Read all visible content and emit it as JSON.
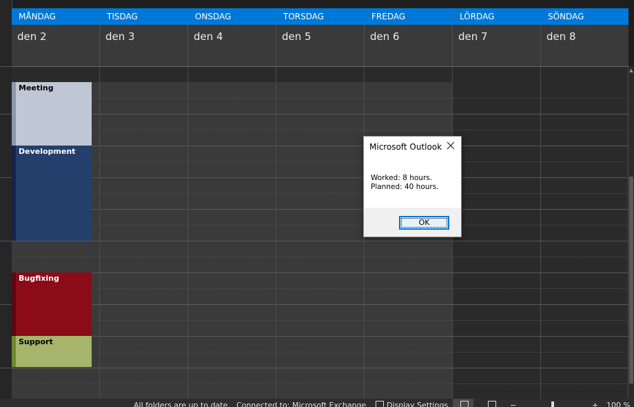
{
  "calendar": {
    "days": [
      {
        "name": "MÅNDAG",
        "date": "den 2"
      },
      {
        "name": "TISDAG",
        "date": "den 3"
      },
      {
        "name": "ONSDAG",
        "date": "den 4"
      },
      {
        "name": "TORSDAG",
        "date": "den 5"
      },
      {
        "name": "FREDAG",
        "date": "den 6"
      },
      {
        "name": "LÖRDAG",
        "date": "den 7"
      },
      {
        "name": "SÖNDAG",
        "date": "den 8"
      }
    ],
    "events": [
      {
        "title": "Meeting",
        "color": "#bfc7d5",
        "accent": "#8c96ad",
        "text_color": "#000000"
      },
      {
        "title": "Development",
        "color": "#243f6b",
        "accent": "#16244a",
        "text_color": "#ffffff"
      },
      {
        "title": "Bugfixing",
        "color": "#8c0b19",
        "accent": "#5c0610",
        "text_color": "#ffffff"
      },
      {
        "title": "Support",
        "color": "#a6b56a",
        "accent": "#6e8a2c",
        "text_color": "#000000"
      }
    ]
  },
  "dialog": {
    "title": "Microsoft Outlook",
    "close_icon": "close-icon",
    "message_line1": "Worked: 8 hours.",
    "message_line2": "Planned: 40 hours.",
    "ok_label": "OK"
  },
  "statusbar": {
    "sync_status": "All folders are up to date.",
    "connection_status": "Connected to: Microsoft Exchange",
    "display_settings_label": "Display Settings",
    "zoom_minus": "−",
    "zoom_plus": "+",
    "zoom_level": "100 %"
  },
  "colors": {
    "accent": "#0078d7",
    "workday_bg": "#3a3a3a",
    "weekend_bg": "#2a2a2a"
  }
}
